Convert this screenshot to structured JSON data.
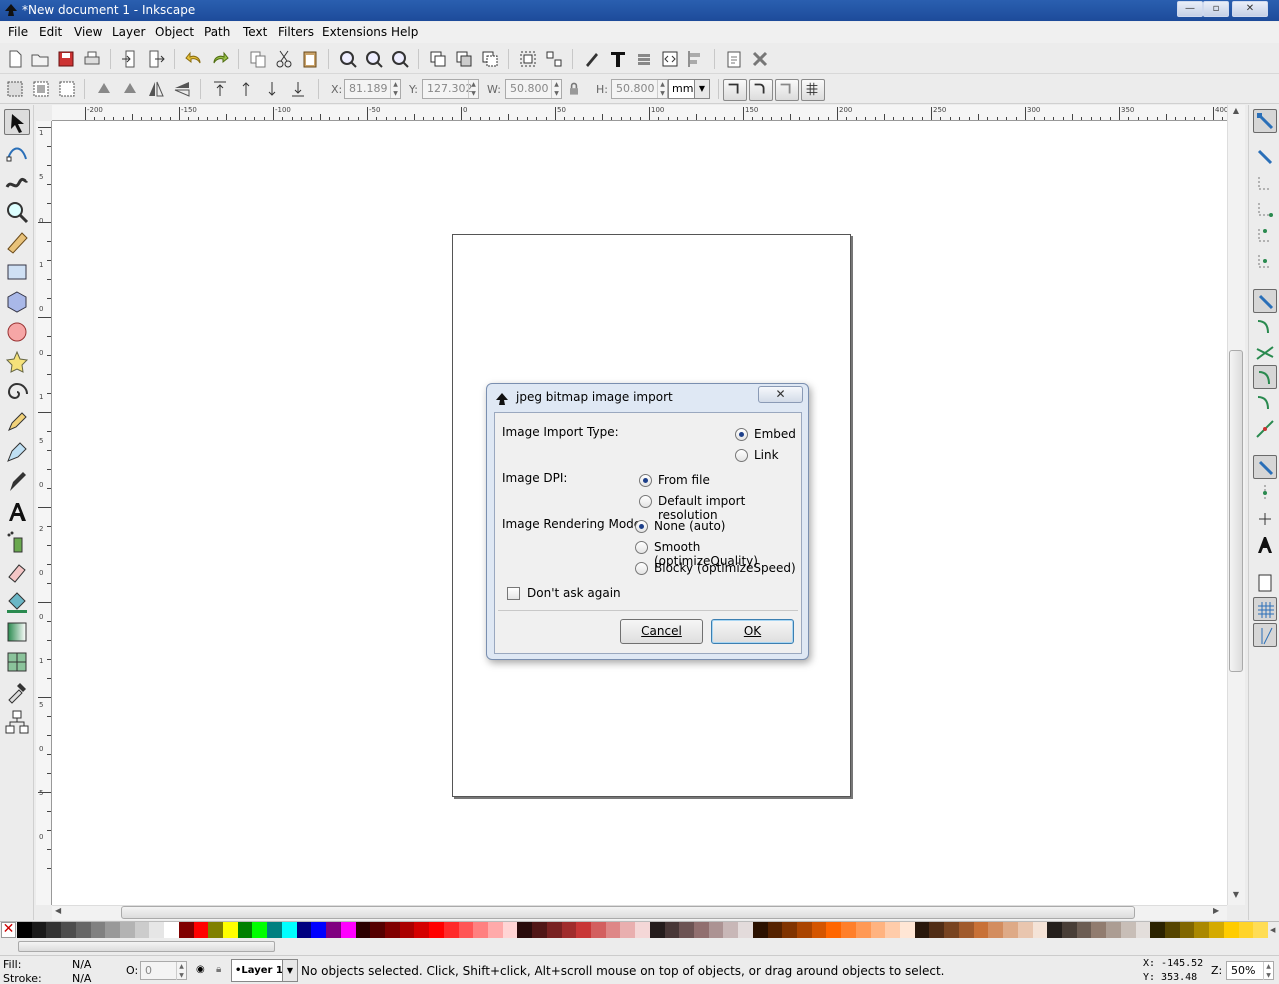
{
  "window": {
    "title": "*New document 1 - Inkscape",
    "controls": {
      "minimize": "—",
      "maximize": "▫",
      "close": "✕"
    }
  },
  "menu": [
    "File",
    "Edit",
    "View",
    "Layer",
    "Object",
    "Path",
    "Text",
    "Filters",
    "Extensions",
    "Help"
  ],
  "controls": {
    "x_label": "X:",
    "x_value": "81.189",
    "y_label": "Y:",
    "y_value": "127.302",
    "w_label": "W:",
    "w_value": "50.800",
    "h_label": "H:",
    "h_value": "50.800",
    "unit": "mm"
  },
  "rulers": {
    "h_labels": [
      "-200",
      "-150",
      "-100",
      "-50",
      "0",
      "50",
      "100",
      "150",
      "200",
      "250",
      "300",
      "350",
      "400"
    ],
    "v_labels": [
      "1",
      "5",
      "0",
      "1",
      "0",
      "0",
      "1",
      "5",
      "0",
      "2",
      "0",
      "0",
      "1",
      "5",
      "0",
      "5",
      "0"
    ]
  },
  "dialog": {
    "title": "jpeg bitmap image import",
    "close": "✕",
    "import_type_label": "Image Import Type:",
    "embed": "Embed",
    "link": "Link",
    "dpi_label": "Image DPI:",
    "from_file": "From file",
    "default_res": "Default import resolution",
    "render_label": "Image Rendering Mode:",
    "none_auto": "None (auto)",
    "smooth": "Smooth (optimizeQuality)",
    "blocky": "Blocky (optimizeSpeed)",
    "dont_ask": "Don't ask again",
    "cancel": "Cancel",
    "ok": "OK"
  },
  "status": {
    "fill_label": "Fill:",
    "fill_value": "N/A",
    "stroke_label": "Stroke:",
    "stroke_value": "N/A",
    "opacity_label": "O:",
    "opacity_value": "0",
    "layer": "•Layer 1",
    "message": "No objects selected. Click, Shift+click, Alt+scroll mouse on top of objects, or drag around objects to select.",
    "cursor_x": "X: -145.52",
    "cursor_y": "Y:  353.48",
    "zoom_label": "Z:",
    "zoom_value": "50%"
  },
  "palette_colors": [
    "#000000",
    "#1a1a1a",
    "#333333",
    "#4d4d4d",
    "#666666",
    "#808080",
    "#999999",
    "#b3b3b3",
    "#cccccc",
    "#e6e6e6",
    "#ffffff",
    "#800000",
    "#ff0000",
    "#808000",
    "#ffff00",
    "#008000",
    "#00ff00",
    "#008080",
    "#00ffff",
    "#000080",
    "#0000ff",
    "#800080",
    "#ff00ff",
    "#2b0000",
    "#550000",
    "#800000",
    "#aa0000",
    "#d40000",
    "#ff0000",
    "#ff2a2a",
    "#ff5555",
    "#ff8080",
    "#ffaaaa",
    "#ffd5d5",
    "#280b0b",
    "#501616",
    "#782121",
    "#a02c2c",
    "#c83737",
    "#d35f5f",
    "#de8787",
    "#e9afaf",
    "#f4d7d7",
    "#241c1c",
    "#483737",
    "#6c5353",
    "#916f6f",
    "#ac9393",
    "#c8b7b7",
    "#e3dbdb",
    "#2b1100",
    "#552200",
    "#803300",
    "#aa4400",
    "#d45500",
    "#ff6600",
    "#ff7f2a",
    "#ff9955",
    "#ffb380",
    "#ffccaa",
    "#ffe6d5",
    "#28170b",
    "#502d16",
    "#784421",
    "#a05a2c",
    "#c87137",
    "#d38d5f",
    "#deaa87",
    "#e9c6af",
    "#f4e3d7",
    "#241f1c",
    "#483e37",
    "#6c5d53",
    "#917c6f",
    "#ac9d93",
    "#c8beb7",
    "#e3dedb",
    "#2b2200",
    "#554400",
    "#806600",
    "#aa8800",
    "#d4aa00",
    "#ffcc00",
    "#ffd42a",
    "#ffdd55"
  ]
}
